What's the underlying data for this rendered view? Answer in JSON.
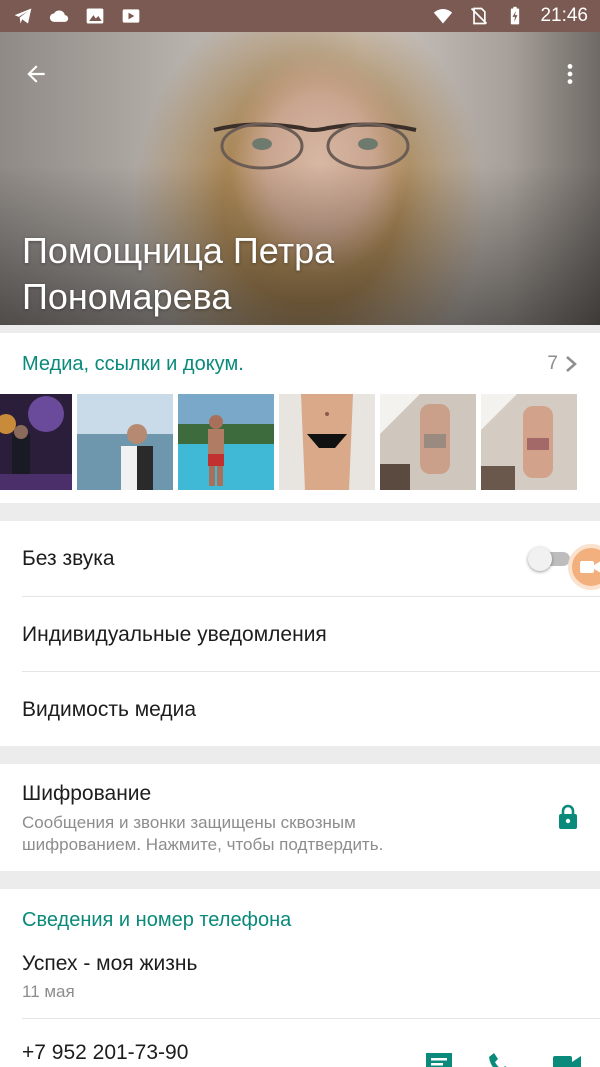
{
  "status_bar": {
    "time": "21:46",
    "icons": [
      "telegram-icon",
      "cloud-icon",
      "image-icon",
      "video-icon",
      "wifi-icon",
      "no-sim-icon",
      "battery-charging-icon"
    ]
  },
  "header": {
    "contact_name": "Помощница Петра Пономарева",
    "back_icon": "arrow-back-icon",
    "menu_icon": "more-vert-icon"
  },
  "media": {
    "title": "Медиа, ссылки и докум.",
    "count": "7",
    "thumbnails": [
      "night-photo",
      "sea-photo",
      "pool-photo",
      "beach-photo",
      "mirror-selfie-1",
      "mirror-selfie-2"
    ]
  },
  "settings": {
    "mute_label": "Без звука",
    "mute_on": false,
    "custom_notifications_label": "Индивидуальные уведомления",
    "media_visibility_label": "Видимость медиа"
  },
  "encryption": {
    "title": "Шифрование",
    "description": "Сообщения и звонки защищены сквозным шифрованием. Нажмите, чтобы подтвердить."
  },
  "info": {
    "title": "Сведения и номер телефона",
    "status_text": "Успех - моя жизнь",
    "status_date": "11 мая",
    "phone": "+7 952 201-73-90"
  },
  "colors": {
    "accent": "#0a8a7a",
    "status_bar": "#7a5a52",
    "secondary_text": "#8d8d8d"
  }
}
